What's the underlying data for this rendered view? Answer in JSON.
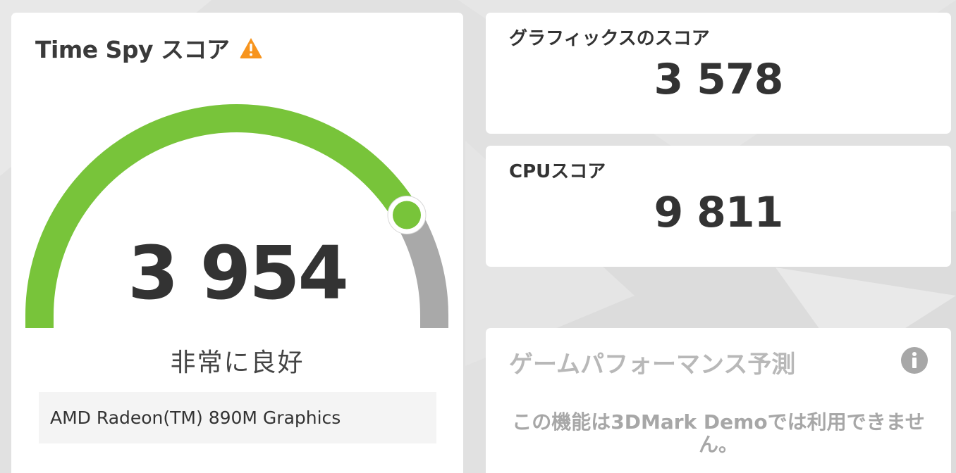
{
  "main": {
    "title": "Time Spy スコア",
    "warning_icon": "warning-triangle-icon",
    "score": "3 954",
    "rating": "非常に良好",
    "gpu_name": "AMD Radeon(TM) 890M Graphics",
    "gauge": {
      "fill_fraction": 0.83,
      "fill_color": "#78c43a",
      "track_color": "#a9a9a9"
    }
  },
  "graphics": {
    "label": "グラフィックスのスコア",
    "value": "3 578"
  },
  "cpu": {
    "label": "CPUスコア",
    "value": "9 811"
  },
  "game_performance": {
    "title": "ゲームパフォーマンス予測",
    "info_icon": "info-icon",
    "message": "この機能は3DMark Demoでは利用できません。"
  },
  "colors": {
    "warning": "#f7941d",
    "accent_green": "#78c43a",
    "muted_text": "#b0b0b0"
  }
}
